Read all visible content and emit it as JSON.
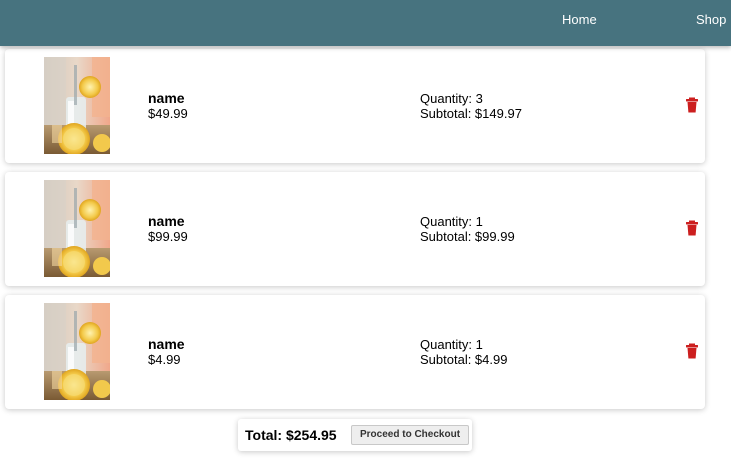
{
  "nav": {
    "home_label": "Home",
    "shop_label": "Shop"
  },
  "cart": {
    "items": [
      {
        "name": "name",
        "price": "$49.99",
        "quantity": "Quantity: 3",
        "subtotal": "Subtotal: $149.97"
      },
      {
        "name": "name",
        "price": "$99.99",
        "quantity": "Quantity: 1",
        "subtotal": "Subtotal: $99.99"
      },
      {
        "name": "name",
        "price": "$4.99",
        "quantity": "Quantity: 1",
        "subtotal": "Subtotal: $4.99"
      }
    ],
    "total": "Total: $254.95",
    "checkout_label": "Proceed to Checkout"
  },
  "colors": {
    "navbar": "#47737f",
    "delete_icon": "#cc1f1f"
  },
  "icons": {
    "delete": "trash-icon",
    "product": "product-image"
  }
}
